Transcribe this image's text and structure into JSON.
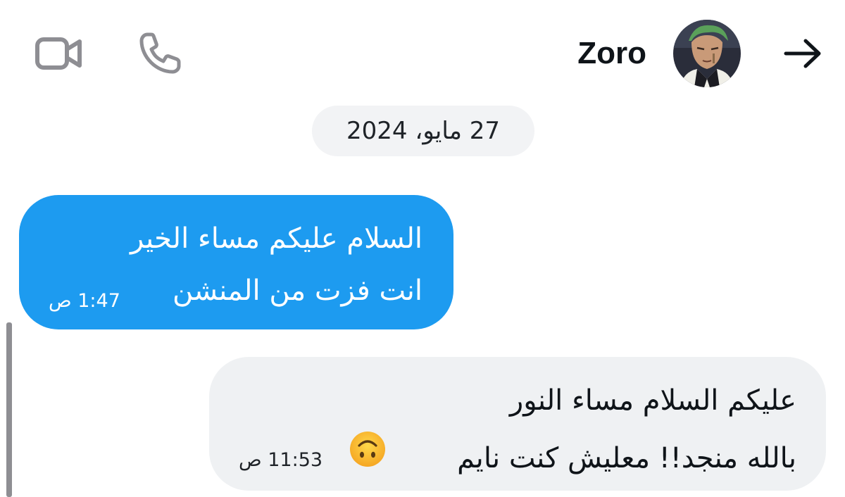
{
  "header": {
    "contact_name": "Zoro",
    "icons": {
      "video": "video-camera-icon",
      "phone": "phone-icon",
      "back": "arrow-right-icon"
    }
  },
  "conversation": {
    "date_label": "27 مايو، 2024",
    "messages": [
      {
        "direction": "outgoing",
        "lines": [
          "السلام عليكم مساء الخير",
          "انت فزت من المنشن"
        ],
        "time": "1:47 ص",
        "bubble_color": "#1d9bf0"
      },
      {
        "direction": "incoming",
        "lines": [
          "عليكم السلام مساء النور",
          "بالله منجد!! معليش كنت نايم"
        ],
        "emoji": "upside-down-face-emoji",
        "time": "11:53 ص",
        "bubble_color": "#eff1f3"
      }
    ]
  },
  "colors": {
    "accent": "#1d9bf0",
    "incoming_bubble": "#eff1f3",
    "icon_gray": "#8e8e93"
  }
}
